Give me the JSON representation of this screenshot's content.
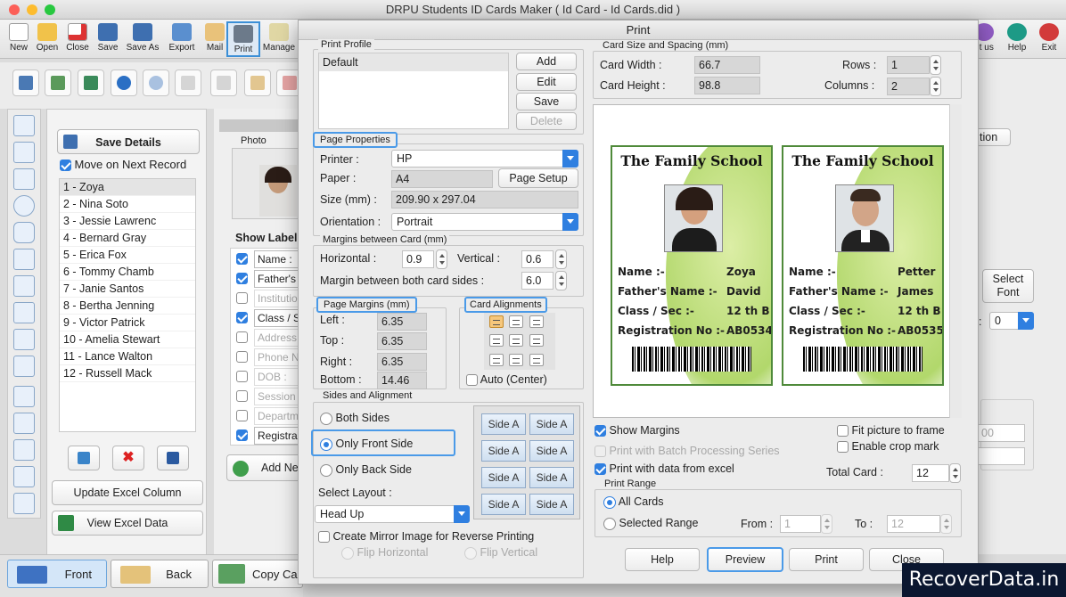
{
  "app": {
    "title": "DRPU Students ID Cards Maker ( Id Card - Id Cards.did )"
  },
  "toolbar": {
    "new": "New",
    "open": "Open",
    "close": "Close",
    "save": "Save",
    "save_as": "Save As",
    "export": "Export",
    "mail": "Mail",
    "print": "Print",
    "manage": "Manage",
    "about": "ut us",
    "help": "Help",
    "exit": "Exit"
  },
  "left": {
    "save_details": "Save Details",
    "move_next": "Move on Next Record",
    "records": [
      "1 - Zoya",
      "2 - Nina Soto",
      "3 - Jessie Lawrenc",
      "4 - Bernard Gray",
      "5 - Erica Fox",
      "6 - Tommy Chamb",
      "7 - Janie Santos",
      "8 - Bertha Jenning",
      "9 - Victor Patrick",
      "10 - Amelia Stewart",
      "11 - Lance Walton",
      "12 - Russell Mack"
    ],
    "update_excel": "Update Excel Column",
    "view_excel": "View Excel Data"
  },
  "middle": {
    "photo": "Photo",
    "show_label": "Show Label",
    "fields": [
      "Name :",
      "Father's",
      "Institutio",
      "Class / S",
      "Address",
      "Phone N",
      "DOB :",
      "Session",
      "Departm",
      "Registra"
    ],
    "add_new": "Add Ne"
  },
  "bottom": {
    "front": "Front",
    "back": "Back",
    "copy": "Copy Ca"
  },
  "right": {
    "tion": "tion",
    "select_font": "Select Font",
    "font_val": "0",
    "dim_val": "00"
  },
  "dialog": {
    "title": "Print",
    "print_profile": {
      "label": "Print Profile",
      "items": [
        "Default"
      ],
      "add": "Add",
      "edit": "Edit",
      "save": "Save",
      "delete": "Delete"
    },
    "page_properties": {
      "label": "Page Properties",
      "printer_label": "Printer :",
      "printer": "HP",
      "paper_label": "Paper :",
      "paper": "A4",
      "page_setup": "Page Setup",
      "size_label": "Size (mm) :",
      "size": "209.90 x 297.04",
      "orientation_label": "Orientation :",
      "orientation": "Portrait"
    },
    "margins_between": {
      "label": "Margins between Card (mm)",
      "horizontal_label": "Horizontal :",
      "horizontal": "0.9",
      "vertical_label": "Vertical :",
      "vertical": "0.6",
      "both_label": "Margin between both card sides :",
      "both": "6.0"
    },
    "page_margins": {
      "label": "Page Margins (mm)",
      "left_label": "Left :",
      "left": "6.35",
      "top_label": "Top :",
      "top": "6.35",
      "right_label": "Right :",
      "right": "6.35",
      "bottom_label": "Bottom :",
      "bottom": "14.46"
    },
    "card_alignments": {
      "label": "Card Alignments",
      "auto_center": "Auto (Center)"
    },
    "sides": {
      "label": "Sides and Alignment",
      "both": "Both Sides",
      "front": "Only Front Side",
      "back": "Only Back Side",
      "select_layout": "Select Layout :",
      "layout": "Head Up",
      "side_a": "Side A",
      "mirror": "Create Mirror Image for Reverse Printing",
      "flip_h": "Flip Horizontal",
      "flip_v": "Flip Vertical"
    },
    "card_size": {
      "label": "Card Size and Spacing (mm)",
      "width_label": "Card Width :",
      "width": "66.7",
      "height_label": "Card Height :",
      "height": "98.8",
      "rows_label": "Rows :",
      "rows": "1",
      "columns_label": "Columns :",
      "columns": "2"
    },
    "cards": [
      {
        "school": "The Family School",
        "name_label": "Name :-",
        "name": "Zoya",
        "father_label": "Father's Name :-",
        "father": "David",
        "class_label": "Class / Sec :-",
        "class": "12 th B",
        "reg_label": "Registration No :-",
        "reg": "AB0534"
      },
      {
        "school": "The Family School",
        "name_label": "Name :-",
        "name": "Petter",
        "father_label": "Father's Name :-",
        "father": "James",
        "class_label": "Class / Sec :-",
        "class": "12 th B",
        "reg_label": "Registration No :-",
        "reg": "AB0535"
      }
    ],
    "options": {
      "show_margins": "Show Margins",
      "batch": "Print with Batch Processing Series",
      "excel": "Print with data from excel",
      "fit_picture": "Fit picture to frame",
      "crop_mark": "Enable crop mark",
      "total_label": "Total Card :",
      "total": "12"
    },
    "print_range": {
      "label": "Print Range",
      "all": "All Cards",
      "selected": "Selected Range",
      "from_label": "From :",
      "from": "1",
      "to_label": "To :",
      "to": "12"
    },
    "buttons": {
      "help": "Help",
      "preview": "Preview",
      "print": "Print",
      "close": "Close"
    }
  },
  "watermark": "RecoverData.in",
  "colors": {
    "accent": "#2f7fe0",
    "highlight": "#4a9ae8",
    "card_border": "#4f8a3a"
  }
}
